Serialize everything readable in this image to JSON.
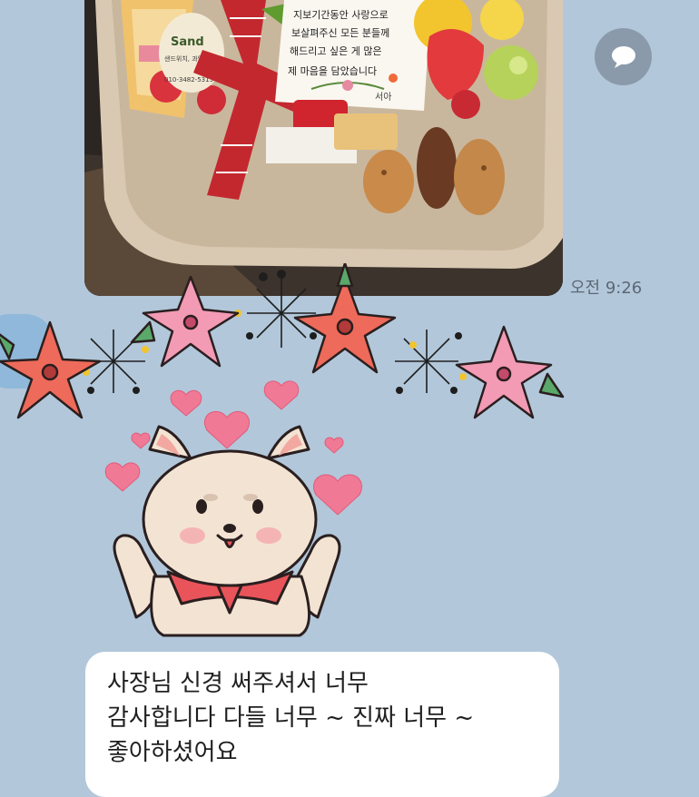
{
  "photo_message": {
    "card_lines": [
      "지보기간동안 사랑으로",
      "보살펴주신 모든 분들께",
      "해드리고 싶은 게 많은",
      "제 마음을 담았습니다"
    ],
    "card_signature": "서아",
    "tag_brand": "Sand",
    "tag_sub": "샌드위치, 과일도시",
    "tag_phone": "010-3482-5315",
    "timestamp": "오전 9:26"
  },
  "incoming_message": {
    "partial_text": "",
    "lines": [
      "사장님 신경 써주셔서 너무",
      "감사합니다 다들 너무 ~ 진짜 너무 ~",
      "좋아하셨어요"
    ]
  },
  "icons": {
    "share": "speech-bubble-icon",
    "sticker": "dog-with-hearts-and-flowers-sticker"
  },
  "colors": {
    "background": "#b2c7da",
    "bubble": "#ffffff",
    "share_button": "#8a9aaa"
  }
}
